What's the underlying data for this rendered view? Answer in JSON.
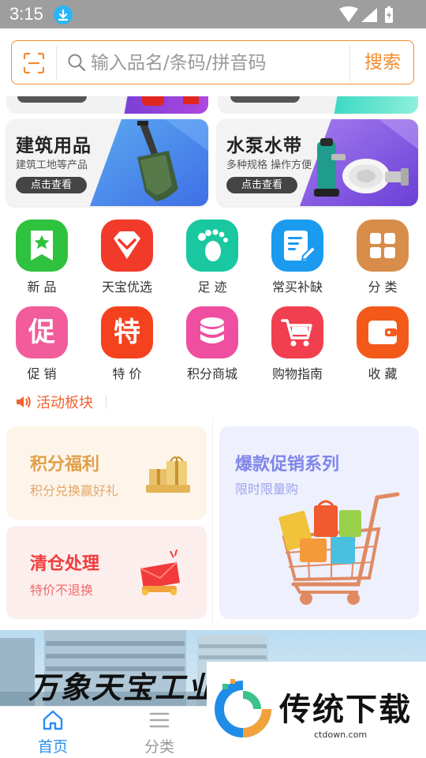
{
  "status_bar": {
    "time": "3:15"
  },
  "search": {
    "placeholder": "输入品名/条码/拼音码",
    "button_label": "搜索"
  },
  "categories": [
    {
      "title": "建筑用品",
      "subtitle": "建筑工地等产品",
      "button": "点击查看"
    },
    {
      "title": "水泵水带",
      "subtitle": "多种规格 操作方便",
      "button": "点击查看"
    }
  ],
  "grid": [
    {
      "label": "新 品",
      "icon": "star-bookmark-icon",
      "color": "#2fc23f"
    },
    {
      "label": "天宝优选",
      "icon": "diamond-icon",
      "color": "#f23a2a"
    },
    {
      "label": "足 迹",
      "icon": "footprint-icon",
      "color": "#19c8a0"
    },
    {
      "label": "常买补缺",
      "icon": "note-edit-icon",
      "color": "#1a9bf0"
    },
    {
      "label": "分 类",
      "icon": "grid-icon",
      "color": "#d98d4a"
    },
    {
      "label": "促 销",
      "icon": "promo-char-icon",
      "glyph": "促",
      "color": "#f25c9b"
    },
    {
      "label": "特 价",
      "icon": "special-char-icon",
      "glyph": "特",
      "color": "#f5421e"
    },
    {
      "label": "积分商城",
      "icon": "database-icon",
      "color": "#ee4fa0"
    },
    {
      "label": "购物指南",
      "icon": "cart-icon",
      "color": "#f23f4f"
    },
    {
      "label": "收 藏",
      "icon": "wallet-icon",
      "color": "#f35a19"
    }
  ],
  "activity": {
    "title": "活动板块",
    "cards": [
      {
        "title": "积分福利",
        "subtitle": "积分兑换赢好礼"
      },
      {
        "title": "清仓处理",
        "subtitle": "特价不退换"
      },
      {
        "title": "爆款促销系列",
        "subtitle": "限时限量购"
      }
    ]
  },
  "banner": {
    "text": "万象天宝工业"
  },
  "tabs": [
    {
      "label": "首页",
      "active": true
    },
    {
      "label": "分类",
      "active": false
    }
  ],
  "watermark": {
    "title": "传统下载",
    "url": "ctdown.com"
  }
}
